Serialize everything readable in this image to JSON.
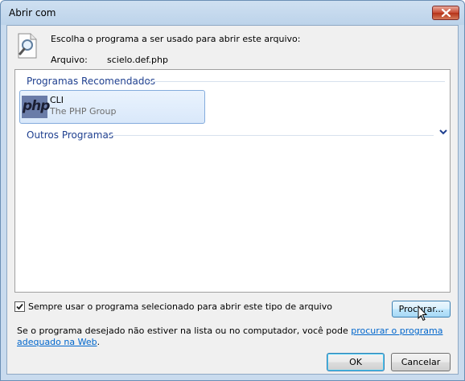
{
  "window": {
    "title": "Abrir com",
    "close_icon": "close-icon"
  },
  "header": {
    "icon": "magnifier-document-icon",
    "choose_text": "Escolha o programa a ser usado para abrir este arquivo:",
    "file_label": "Arquivo:",
    "file_value": "scielo.def.php"
  },
  "program_list": {
    "recommended_header": "Programas Recomendados",
    "other_header": "Outros Programas",
    "expand_icon": "chevron-down-icon",
    "items": [
      {
        "name": "CLI",
        "publisher": "The PHP Group",
        "icon_text": "php",
        "selected": true
      }
    ]
  },
  "options": {
    "always_use_checked": true,
    "always_use_label": "Sempre usar o programa selecionado para abrir este tipo de arquivo",
    "browse_label": "Procurar..."
  },
  "footer": {
    "text_before_link": "Se o programa desejado não estiver na lista ou no computador, você pode ",
    "link_text": "procurar o programa adequado na Web",
    "text_after_link": "."
  },
  "buttons": {
    "ok_label": "OK",
    "cancel_label": "Cancelar"
  },
  "colors": {
    "accent_header": "#1e3f8f",
    "link": "#0066cc",
    "close_button": "#c74a33",
    "selection_border": "#84acdd"
  }
}
